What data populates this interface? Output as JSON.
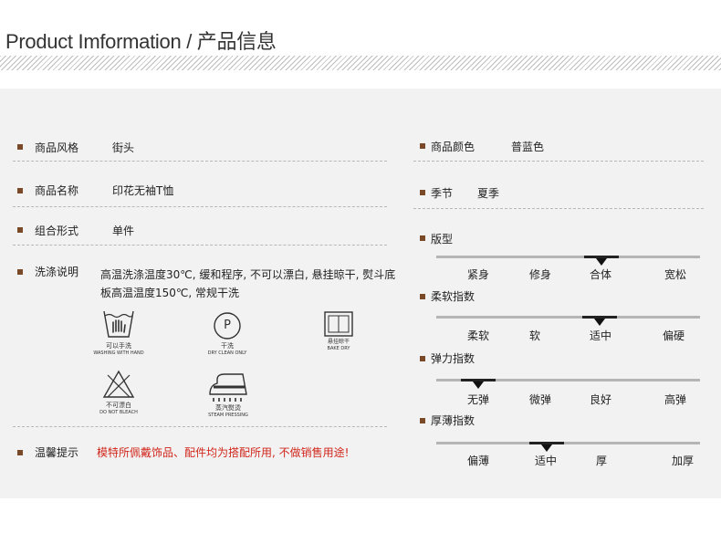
{
  "header": {
    "title": "Product Imformation / 产品信息"
  },
  "left": {
    "rows": [
      {
        "label": "商品风格",
        "value": "街头"
      },
      {
        "label": "商品名称",
        "value": "印花无袖T恤"
      },
      {
        "label": "组合形式",
        "value": "单件"
      }
    ],
    "care": {
      "label": "洗涤说明",
      "text": "高温洗涤温度30℃, 缓和程序, 不可以漂白, 悬挂晾干, 熨斗底板高温温度150℃, 常规干洗",
      "icons": [
        {
          "icon": "hand-wash-icon",
          "cn": "可以手洗",
          "en": "WASHING WITH HAND"
        },
        {
          "icon": "dry-clean-icon",
          "cn": "干洗",
          "en": "DRY CLEAN ONLY",
          "symbol": "P"
        },
        {
          "icon": "hang-dry-icon",
          "cn": "悬挂晾干",
          "en": "BAKE DRY"
        },
        {
          "icon": "no-bleach-icon",
          "cn": "不可漂白",
          "en": "DO NOT BLEACH"
        },
        {
          "icon": "steam-iron-icon",
          "cn": "蒸汽熨烫",
          "en": "STEAM PRESSING"
        }
      ]
    },
    "tip": {
      "label": "温馨提示",
      "text": "模特所佩戴饰品、配件均为搭配所用, 不做销售用途!"
    }
  },
  "right": {
    "color": {
      "label": "商品颜色",
      "value": "普蓝色"
    },
    "season": {
      "label": "季节",
      "value": "夏季"
    },
    "scales": [
      {
        "label": "版型",
        "options": [
          "紧身",
          "修身",
          "合体",
          "宽松"
        ],
        "selected": 2
      },
      {
        "label": "柔软指数",
        "options": [
          "柔软",
          "软",
          "适中",
          "偏硬"
        ],
        "selected": 2
      },
      {
        "label": "弹力指数",
        "options": [
          "无弹",
          "微弹",
          "良好",
          "高弹"
        ],
        "selected": 0
      },
      {
        "label": "厚薄指数",
        "options": [
          "偏薄",
          "适中",
          "厚",
          "加厚"
        ],
        "selected": 1
      }
    ]
  },
  "colors": {
    "accent": "#7a4a28",
    "warning": "#d0261b",
    "panel": "#f2f2f2"
  }
}
